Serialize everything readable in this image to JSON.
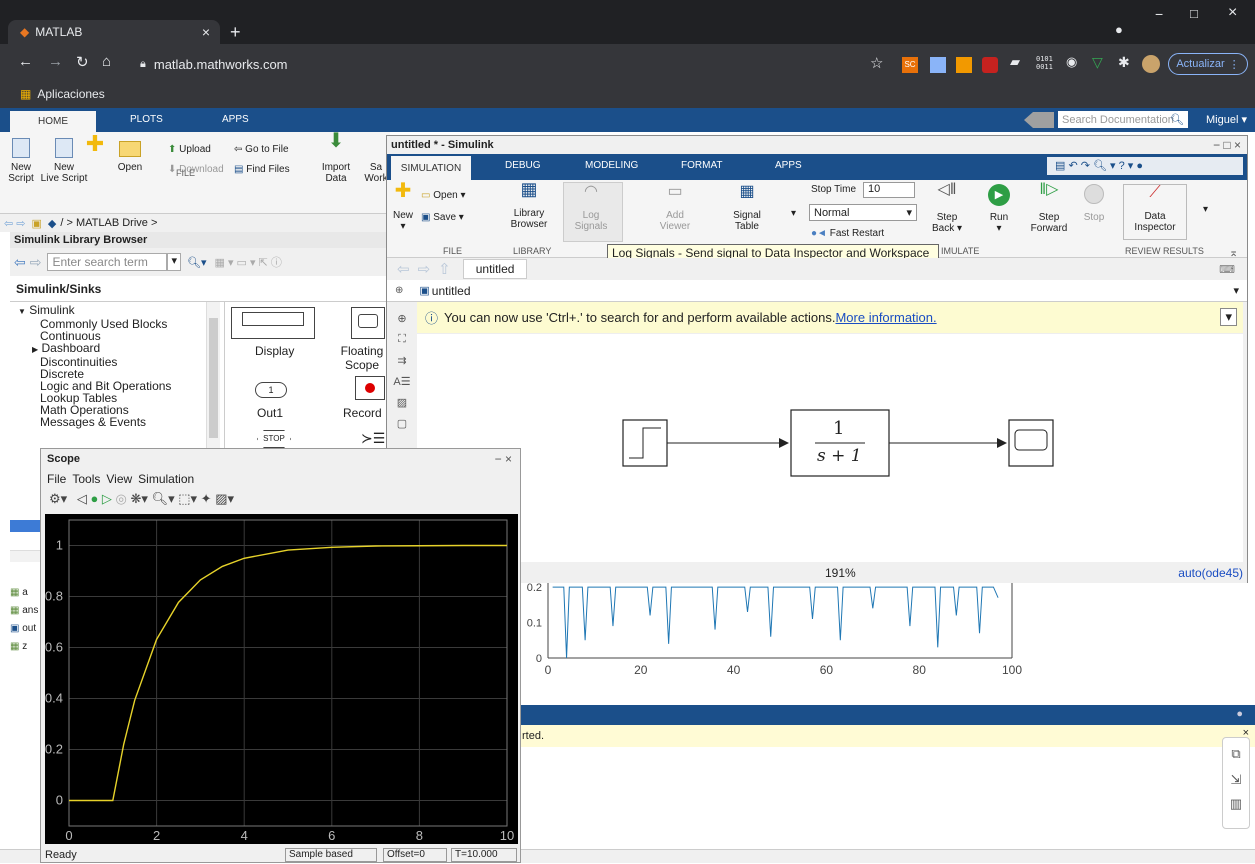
{
  "browser": {
    "tab_title": "MATLAB",
    "url": "matlab.mathworks.com",
    "bookmark_apps": "Aplicaciones",
    "update_button": "Actualizar"
  },
  "matlab": {
    "tabs": [
      "HOME",
      "PLOTS",
      "APPS"
    ],
    "search_placeholder": "Search Documentation",
    "user": "Miguel",
    "ribbon": {
      "new_script": "New\nScript",
      "new_live": "New\nLive Script",
      "open": "Open",
      "upload": "Upload",
      "download": "Download",
      "goto_file": "Go to File",
      "find_files": "Find Files",
      "import_data": "Import\nData",
      "save_work": "Sa\nWork",
      "group_file": "FILE"
    },
    "path": "/ > MATLAB Drive >",
    "workspace": [
      "a",
      "ans",
      "out",
      "z"
    ],
    "cmd_note": "rted.",
    "status": "Ready"
  },
  "library": {
    "title": "Simulink Library Browser",
    "search_placeholder": "Enter search term",
    "current": "Simulink/Sinks",
    "tree_root": "Simulink",
    "tree": [
      "Commonly Used Blocks",
      "Continuous",
      "Dashboard",
      "Discontinuities",
      "Discrete",
      "Logic and Bit Operations",
      "Lookup Tables",
      "Math Operations",
      "Messages & Events"
    ],
    "blocks": [
      "Display",
      "Floating\nScope",
      "Out1",
      "Record"
    ],
    "out1_num": "1",
    "stop_label": "STOP"
  },
  "simulink": {
    "title": "untitled * - Simulink",
    "tabs": [
      "SIMULATION",
      "DEBUG",
      "MODELING",
      "FORMAT",
      "APPS"
    ],
    "ribbon": {
      "new": "New",
      "open": "Open",
      "save": "Save",
      "library_browser": "Library\nBrowser",
      "log_signals": "Log\nSignals",
      "add_viewer": "Add\nViewer",
      "signal_table": "Signal\nTable",
      "stop_time_label": "Stop Time",
      "stop_time_value": "10",
      "mode": "Normal",
      "fast_restart": "Fast Restart",
      "step_back": "Step\nBack",
      "run": "Run",
      "step_forward": "Step\nForward",
      "stop": "Stop",
      "data_inspector": "Data\nInspector",
      "groups": [
        "FILE",
        "LIBRARY",
        "SIMULATE",
        "REVIEW RESULTS"
      ],
      "group_simulate_partial": "IMULATE"
    },
    "tooltip": "Log Signals - Send signal to Data Inspector and Workspace",
    "tab_model": "untitled",
    "breadcrumb": "untitled",
    "notice": "You can now use 'Ctrl+.' to search for and perform available actions.",
    "notice_link": " More information.",
    "tf_num": "1",
    "tf_den": "s + 1",
    "zoom": "191%",
    "solver": "auto(ode45)"
  },
  "scope": {
    "title": "Scope",
    "menus": [
      "File",
      "Tools",
      "View",
      "Simulation"
    ],
    "status": [
      "Ready",
      "Sample based",
      "Offset=0",
      "T=10.000"
    ]
  },
  "chart_data": [
    {
      "type": "line",
      "x": [
        0,
        1,
        1.25,
        1.5,
        2,
        2.5,
        3,
        3.5,
        4,
        5,
        6,
        7,
        8,
        9,
        10
      ],
      "series": [
        {
          "values": [
            0,
            0,
            0.221,
            0.393,
            0.632,
            0.777,
            0.865,
            0.918,
            0.95,
            0.982,
            0.993,
            0.998,
            0.999,
            1.0,
            1.0
          ]
        }
      ],
      "xlim": [
        0,
        10
      ],
      "ylim": [
        -0.1,
        1.1
      ],
      "xticks": [
        0,
        2,
        4,
        6,
        8,
        10
      ],
      "yticks": [
        0,
        0.2,
        0.4,
        0.6,
        0.8,
        1
      ],
      "line_color": "#e6d22a",
      "background": "#000000",
      "grid": true
    },
    {
      "type": "line",
      "xticks": [
        0,
        20,
        40,
        60,
        80,
        100
      ],
      "yticks": [
        0,
        0.1,
        0.2
      ],
      "xlim": [
        0,
        100
      ],
      "ylim": [
        0,
        0.22
      ],
      "line_color": "#1f77b4"
    }
  ]
}
